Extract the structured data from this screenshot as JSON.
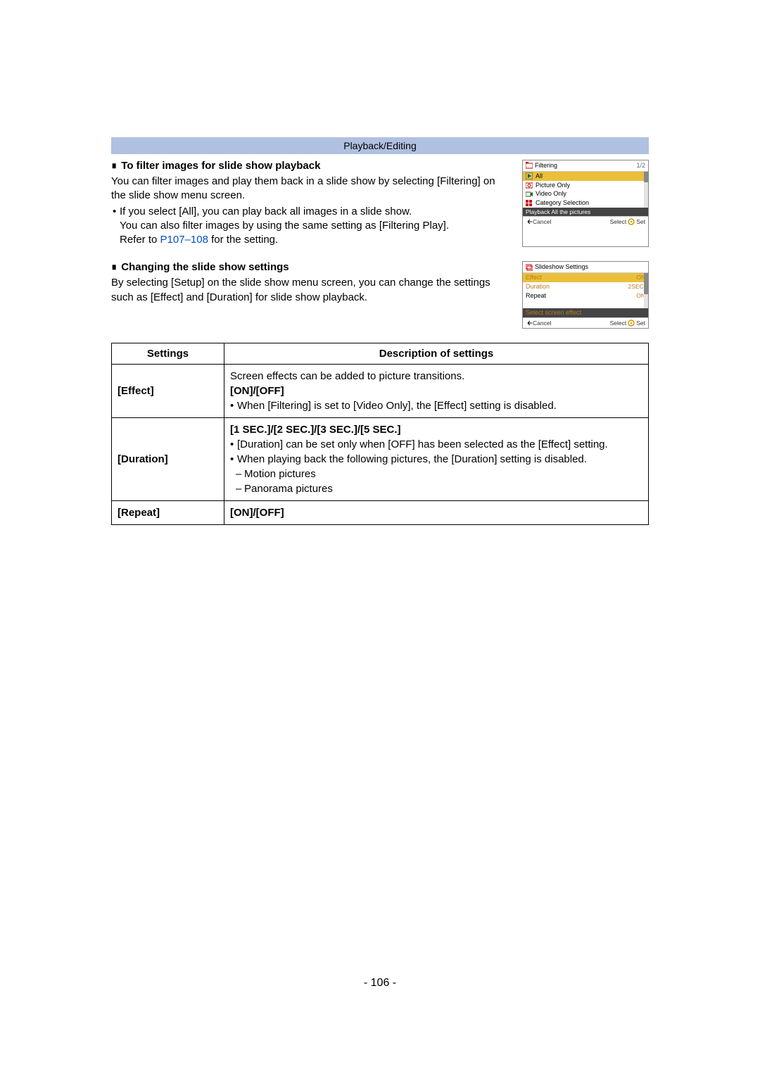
{
  "header": {
    "title": "Playback/Editing"
  },
  "section1": {
    "heading": "To filter images for slide show playback",
    "para": "You can filter images and play them back in a slide show by selecting [Filtering] on the slide show menu screen.",
    "bullet1": "If you select [All], you can play back all images in a slide show.",
    "bullet2a": "You can also filter images by using the same setting as [Filtering Play].",
    "bullet2b_prefix": "Refer to ",
    "bullet2b_link1": "P107",
    "bullet2b_sep": "–",
    "bullet2b_link2": "108",
    "bullet2b_suffix": " for the setting."
  },
  "screen1": {
    "title": "Filtering",
    "page": "1/2",
    "rows": [
      {
        "label": "All"
      },
      {
        "label": "Picture Only"
      },
      {
        "label": "Video Only"
      },
      {
        "label": "Category Selection"
      }
    ],
    "darkbar": "Playback All the pictures",
    "footer_left": "Cancel",
    "footer_right1": "Select",
    "footer_right2": "Set"
  },
  "section2": {
    "heading": "Changing the slide show settings",
    "para": "By selecting [Setup] on the slide show menu screen, you can change the settings such as [Effect] and [Duration] for slide show playback."
  },
  "screen2": {
    "title": "Slideshow Settings",
    "rows": [
      {
        "label": "Effect",
        "value": "ON"
      },
      {
        "label": "Duration",
        "value": "2SEC."
      },
      {
        "label": "Repeat",
        "value": "ON"
      }
    ],
    "darkbar": "Select screen effect",
    "footer_left": "Cancel",
    "footer_right1": "Select",
    "footer_right2": "Set"
  },
  "table": {
    "head_settings": "Settings",
    "head_desc": "Description of settings",
    "rows": [
      {
        "name": "[Effect]",
        "line1": "Screen effects can be added to picture transitions.",
        "bold": "[ON]/[OFF]",
        "bullet": "When [Filtering] is set to [Video Only], the [Effect] setting is disabled."
      },
      {
        "name": "[Duration]",
        "bold": "[1 SEC.]/[2 SEC.]/[3 SEC.]/[5 SEC.]",
        "bullet1": "[Duration] can be set only when [OFF] has been selected as the [Effect] setting.",
        "bullet2": "When playing back the following pictures, the [Duration] setting is disabled.",
        "dash1": "Motion pictures",
        "dash2": "Panorama pictures"
      },
      {
        "name": "[Repeat]",
        "bold": "[ON]/[OFF]"
      }
    ]
  },
  "page_number": "- 106 -"
}
